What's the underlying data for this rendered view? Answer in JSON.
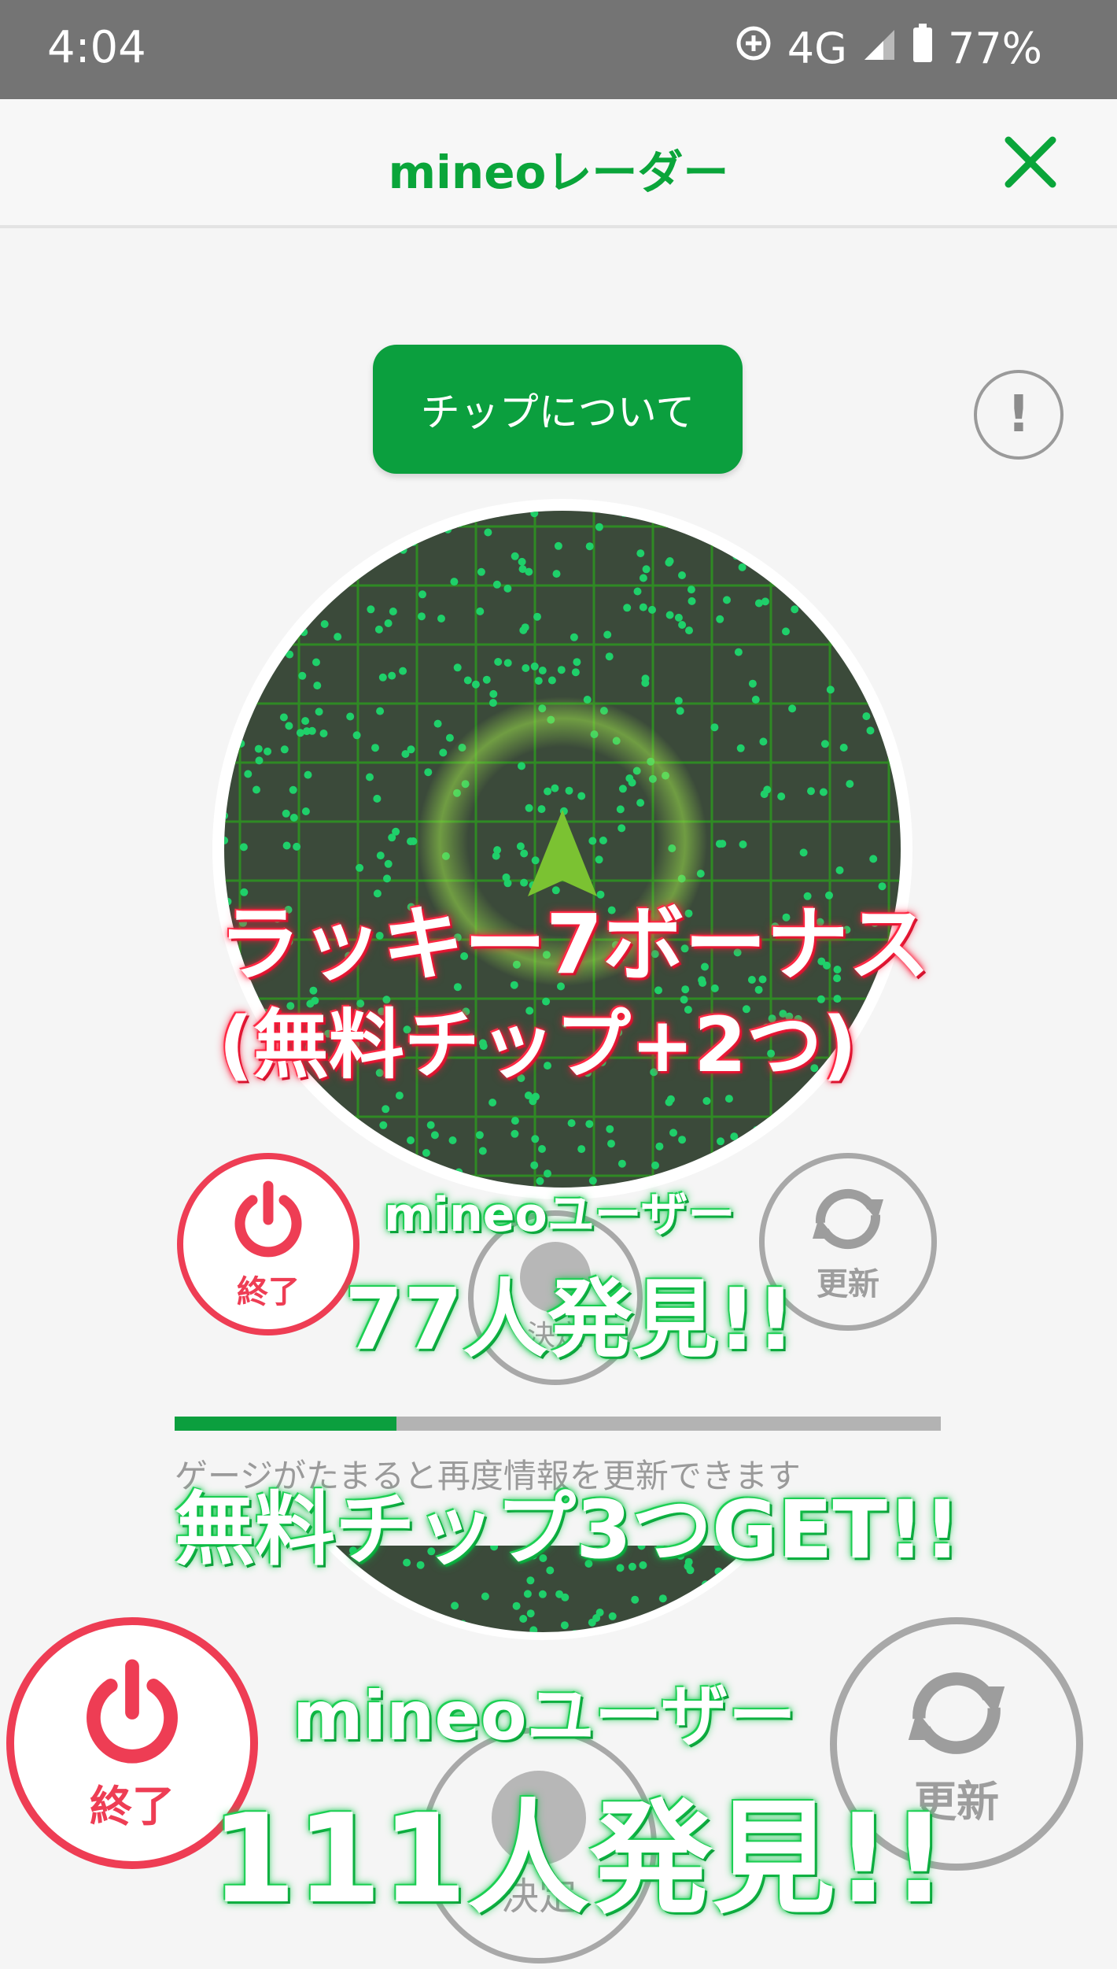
{
  "status_bar": {
    "time": "4:04",
    "network": "4G",
    "battery": "77%"
  },
  "app_bar": {
    "title": "mineoレーダー",
    "close_icon": "close-icon"
  },
  "chip_button": {
    "label": "チップについて"
  },
  "info_button": {
    "label": "!"
  },
  "controls": {
    "end_label": "終了",
    "refresh_label": "更新",
    "decide_label": "決定"
  },
  "progress": {
    "fraction": 0.29,
    "hint": "ゲージがたまると再度情報を更新できます"
  },
  "overlays": {
    "bonus_line1": "ラッキー7ボーナス",
    "bonus_line2": "(無料チップ+2つ)",
    "users_label_1": "mineoユーザー",
    "found_1": "77人発見!!",
    "free_chips": "無料チップ3つGET!!",
    "users_label_2": "mineoユーザー",
    "found_2": "111人発見!!"
  },
  "colors": {
    "accent": "#0b9f3e",
    "danger": "#ee3d54",
    "radar_bg": "#3b4a3a"
  }
}
